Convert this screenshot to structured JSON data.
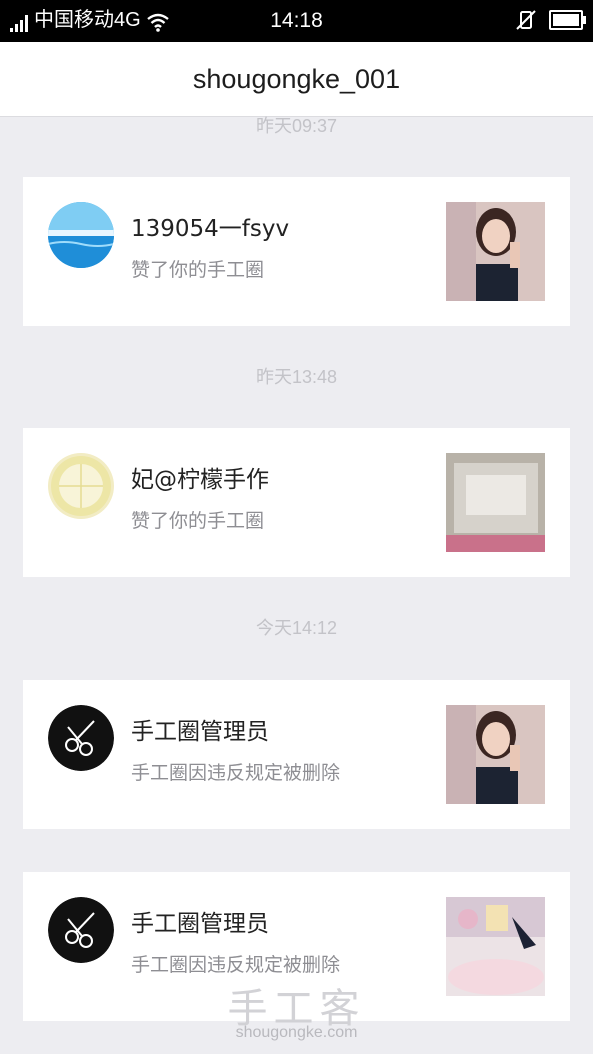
{
  "status_bar": {
    "carrier": "中国移动4G",
    "time": "14:18"
  },
  "header": {
    "title": "shougongke_001"
  },
  "time_labels": [
    "昨天09:37",
    "昨天13:48",
    "今天14:12"
  ],
  "notifications": [
    {
      "name": "139054一fsyv",
      "action": "赞了你的手工圈",
      "avatar": "beach-avatar",
      "thumb": "doll-photo"
    },
    {
      "name": "妃@柠檬手作",
      "action": "赞了你的手工圈",
      "avatar": "lemon-avatar",
      "thumb": "package-photo"
    },
    {
      "name": "手工圈管理员",
      "action": "手工圈因违反规定被删除",
      "avatar": "scissors-avatar",
      "thumb": "doll-photo"
    },
    {
      "name": "手工圈管理员",
      "action": "手工圈因违反规定被删除",
      "avatar": "scissors-avatar",
      "thumb": "crafts-photo"
    }
  ],
  "watermark": {
    "text": "手工客",
    "url": "shougongke.com"
  }
}
